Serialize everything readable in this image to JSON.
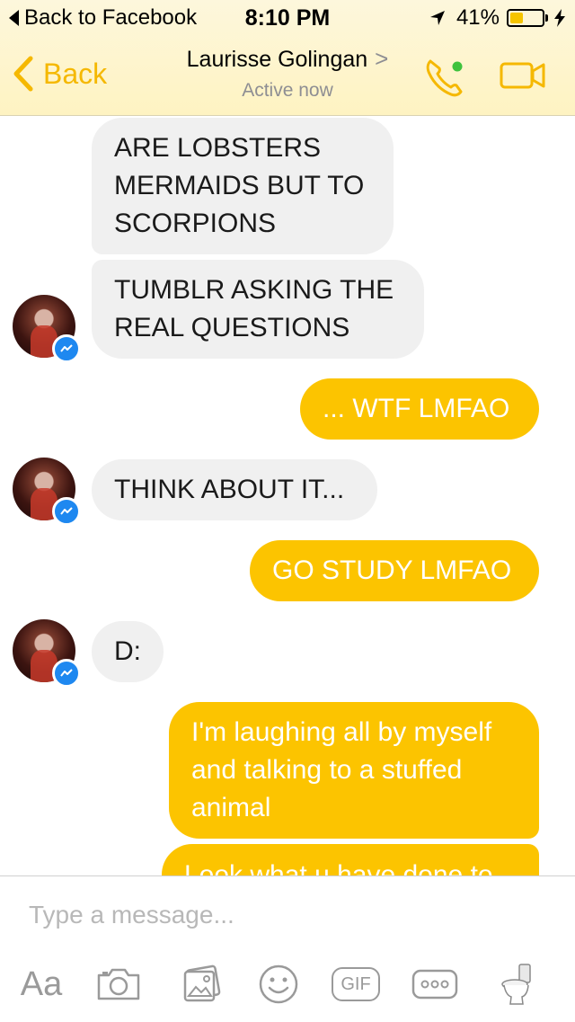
{
  "status_bar": {
    "back_label": "Back to Facebook",
    "time": "8:10 PM",
    "battery_text": "41%",
    "battery_level": 0.41
  },
  "nav": {
    "back_label": "Back",
    "contact_name": "Laurisse Golingan",
    "chevron": ">",
    "contact_status": "Active now",
    "accent": "#f5b800",
    "online_dot": "#3fc23d"
  },
  "messages": [
    {
      "id": "m1",
      "side": "in",
      "text": "ARE LOBSTERS MERMAIDS BUT TO SCORPIONS"
    },
    {
      "id": "m2",
      "side": "in",
      "text": "TUMBLR ASKING THE REAL QUESTIONS"
    },
    {
      "id": "m3",
      "side": "out",
      "text": "... WTF LMFAO"
    },
    {
      "id": "m4",
      "side": "in",
      "text": "THINK ABOUT IT..."
    },
    {
      "id": "m5",
      "side": "out",
      "text": "GO STUDY LMFAO"
    },
    {
      "id": "m6",
      "side": "in",
      "text": "D:"
    },
    {
      "id": "m7",
      "side": "out",
      "text": "I'm laughing all by myself and talking to a stuffed animal"
    },
    {
      "id": "m8",
      "side": "out",
      "text": "Look what u have done to"
    }
  ],
  "composer": {
    "placeholder": "Type a message...",
    "aa_label": "Aa",
    "gif_label": "GIF",
    "icons": [
      "camera-icon",
      "photo-gallery-icon",
      "emoji-icon",
      "gif-icon",
      "more-icon",
      "toilet-sticker-icon"
    ]
  },
  "colors": {
    "outgoing_bubble": "#fcc400",
    "incoming_bubble": "#f0f0f0",
    "messenger_badge": "#1e88f0"
  }
}
